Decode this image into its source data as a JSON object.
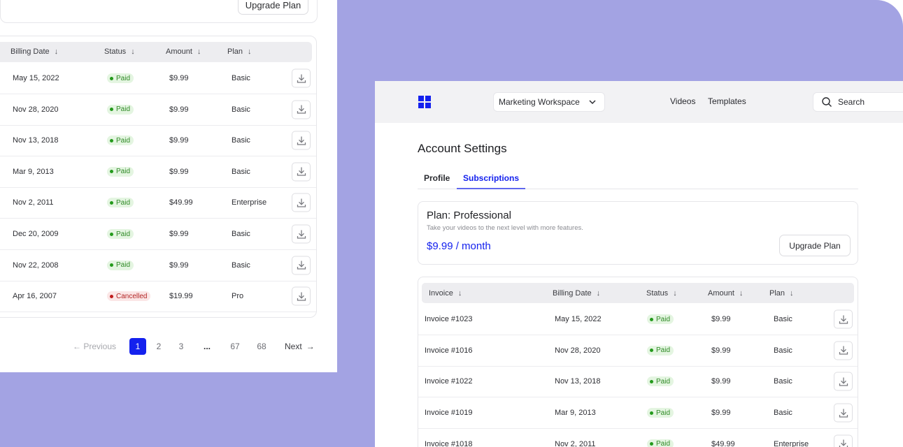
{
  "left_panel": {
    "upgrade_label": "Upgrade Plan",
    "columns": [
      "Billing Date",
      "Status",
      "Amount",
      "Plan"
    ],
    "rows": [
      {
        "date": "May 15, 2022",
        "status": "Paid",
        "amount": "$9.99",
        "plan": "Basic"
      },
      {
        "date": "Nov 28, 2020",
        "status": "Paid",
        "amount": "$9.99",
        "plan": "Basic"
      },
      {
        "date": "Nov 13, 2018",
        "status": "Paid",
        "amount": "$9.99",
        "plan": "Basic"
      },
      {
        "date": "Mar 9, 2013",
        "status": "Paid",
        "amount": "$9.99",
        "plan": "Basic"
      },
      {
        "date": "Nov 2, 2011",
        "status": "Paid",
        "amount": "$49.99",
        "plan": "Enterprise"
      },
      {
        "date": "Dec 20, 2009",
        "status": "Paid",
        "amount": "$9.99",
        "plan": "Basic"
      },
      {
        "date": "Nov 22, 2008",
        "status": "Paid",
        "amount": "$9.99",
        "plan": "Basic"
      },
      {
        "date": "Apr 16, 2007",
        "status": "Cancelled",
        "amount": "$19.99",
        "plan": "Pro"
      }
    ],
    "pagination": {
      "previous": "Previous",
      "pages": [
        "1",
        "2",
        "3",
        "...",
        "67",
        "68"
      ],
      "current": "1",
      "next": "Next"
    }
  },
  "right_panel": {
    "workspace": "Marketing Workspace",
    "nav_links": [
      "Videos",
      "Templates"
    ],
    "search_placeholder": "Search",
    "page_title": "Account Settings",
    "tabs": [
      "Profile",
      "Subscriptions"
    ],
    "active_tab": "Subscriptions",
    "plan": {
      "name": "Plan: Professional",
      "description": "Take your videos to the next level with more features.",
      "price": "$9.99 / month",
      "upgrade_label": "Upgrade Plan"
    },
    "columns": [
      "Invoice",
      "Billing Date",
      "Status",
      "Amount",
      "Plan"
    ],
    "rows": [
      {
        "invoice": "Invoice #1023",
        "date": "May 15, 2022",
        "status": "Paid",
        "amount": "$9.99",
        "plan": "Basic"
      },
      {
        "invoice": "Invoice #1016",
        "date": "Nov 28, 2020",
        "status": "Paid",
        "amount": "$9.99",
        "plan": "Basic"
      },
      {
        "invoice": "Invoice #1022",
        "date": "Nov 13, 2018",
        "status": "Paid",
        "amount": "$9.99",
        "plan": "Basic"
      },
      {
        "invoice": "Invoice #1019",
        "date": "Mar 9, 2013",
        "status": "Paid",
        "amount": "$9.99",
        "plan": "Basic"
      },
      {
        "invoice": "Invoice #1018",
        "date": "Nov 2, 2011",
        "status": "Paid",
        "amount": "$49.99",
        "plan": "Enterprise"
      }
    ]
  },
  "colors": {
    "background": "#a3a3e3",
    "accent": "#1421ee",
    "paid": "#2f8a26",
    "cancelled": "#b32626"
  },
  "icons": [
    "download-icon",
    "chevron-down-icon",
    "search-icon",
    "logo-grid-icon",
    "arrow-down-icon",
    "arrow-left-icon",
    "arrow-right-icon"
  ]
}
